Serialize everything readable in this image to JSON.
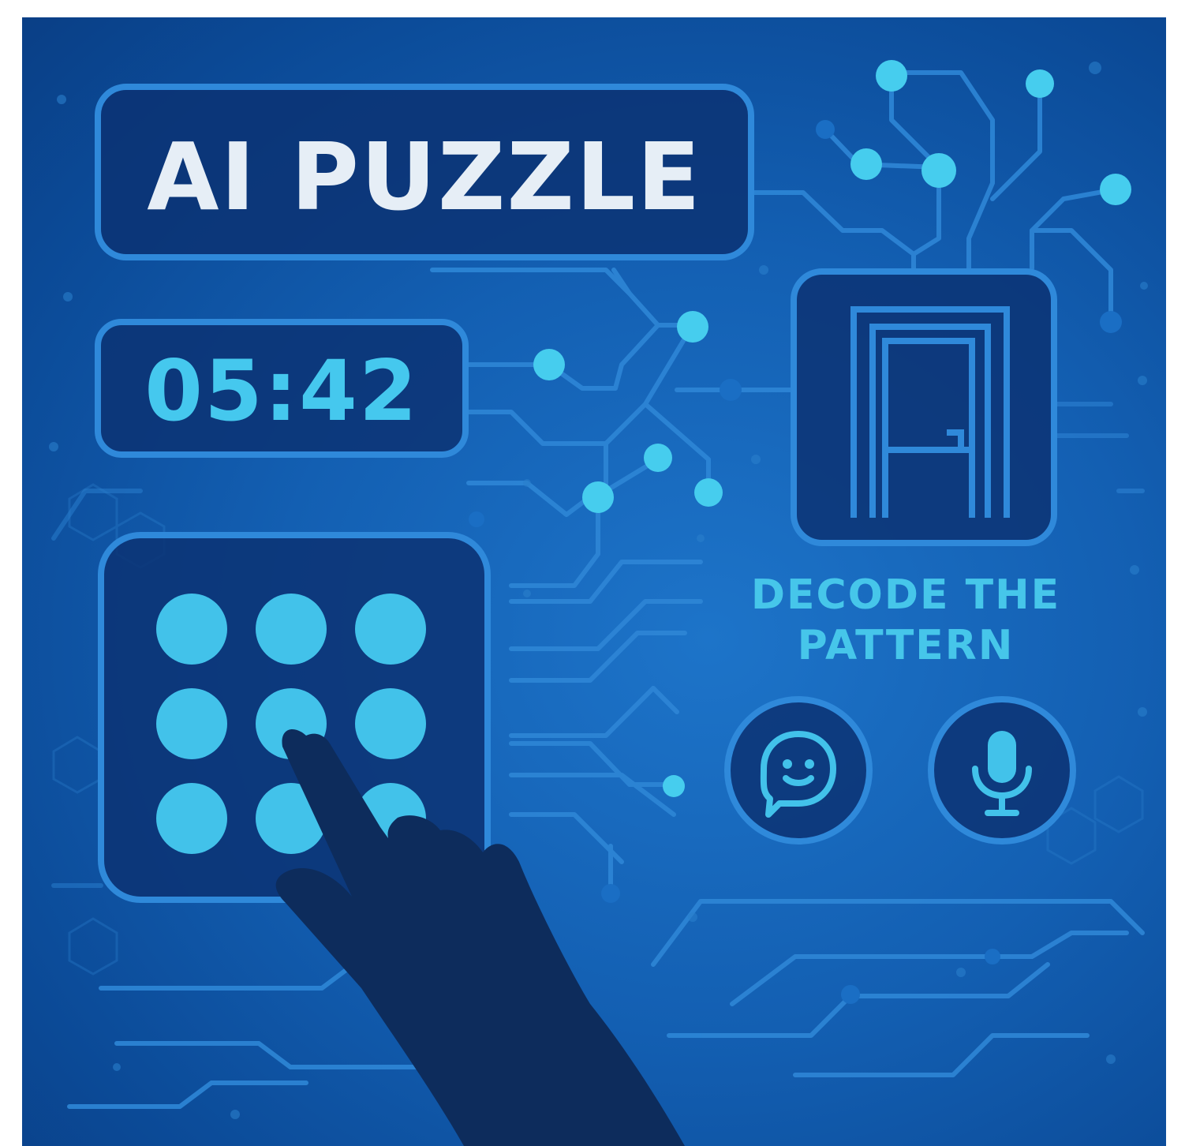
{
  "title": "AI PUZZLE",
  "timer": "05:42",
  "decode_line1": "DECODE THE",
  "decode_line2": "PATTERN",
  "keypad": {
    "rows": 3,
    "cols": 3
  },
  "icons": {
    "chat": "smiley-chat-bubble-icon",
    "mic": "microphone-icon",
    "door": "door-icon",
    "hand": "pointing-hand"
  },
  "colors": {
    "background": "#135fb2",
    "panel": "#0c3273",
    "border": "#2f89da",
    "accent": "#42c2ea",
    "title_text": "#e6eef6",
    "hand": "#0d2c5c"
  }
}
